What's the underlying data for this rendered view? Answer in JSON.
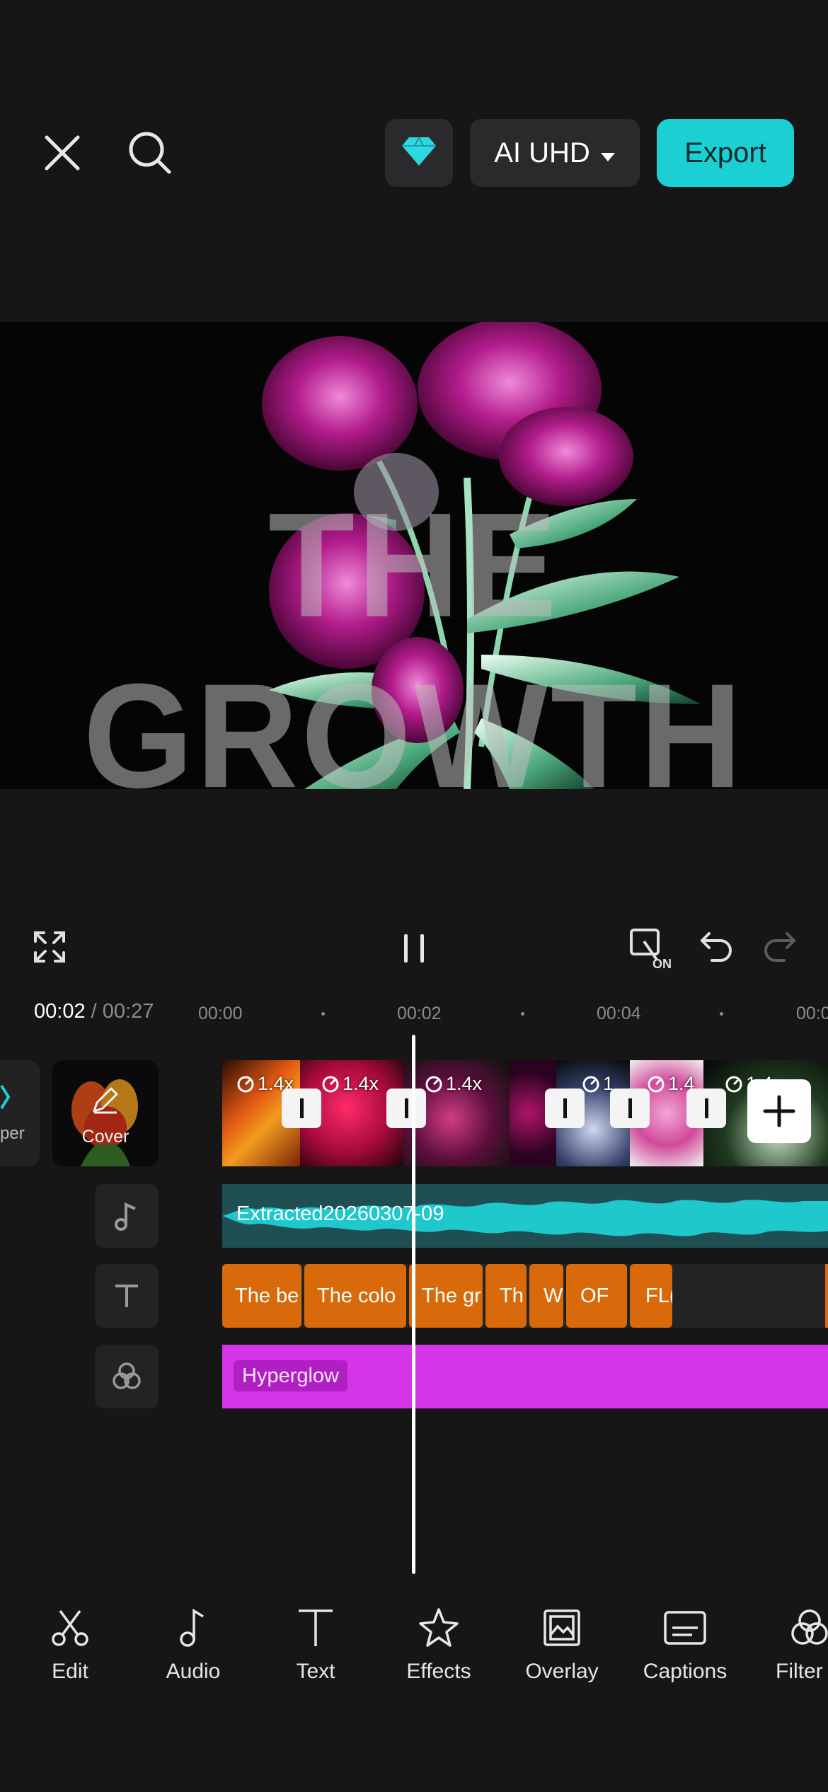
{
  "header": {
    "close_icon": "close-icon",
    "search_icon": "search-icon",
    "premium_icon": "diamond-icon",
    "quality_label": "AI UHD",
    "export_label": "Export",
    "accent_color": "#1ccfd2"
  },
  "preview": {
    "overlay_text": "THE GROWTH"
  },
  "playback": {
    "current_time": "00:02",
    "separator": "/",
    "total_time": "00:27",
    "ruler": [
      "00:00",
      "00:02",
      "00:04",
      "00:0"
    ]
  },
  "timeline": {
    "cover_label": "Cover",
    "side_label": "per",
    "clips": [
      {
        "speed": "1.4x"
      },
      {
        "speed": "1.4x"
      },
      {
        "speed": "1.4x"
      },
      {
        "speed": "1"
      },
      {
        "speed": "1.4"
      },
      {
        "speed": "1.4"
      }
    ],
    "audio_label": "Extracted20260307-09",
    "text_clips": [
      "The be",
      "The colo",
      "The gr",
      "Th",
      "W",
      "OF",
      "FL("
    ],
    "effect_label": "Hyperglow"
  },
  "toolbar": {
    "items": [
      {
        "label": "Edit",
        "icon": "scissors-icon"
      },
      {
        "label": "Audio",
        "icon": "music-note-icon"
      },
      {
        "label": "Text",
        "icon": "text-icon"
      },
      {
        "label": "Effects",
        "icon": "star-icon"
      },
      {
        "label": "Overlay",
        "icon": "overlay-icon"
      },
      {
        "label": "Captions",
        "icon": "captions-icon"
      },
      {
        "label": "Filter",
        "icon": "filter-icon"
      }
    ]
  }
}
